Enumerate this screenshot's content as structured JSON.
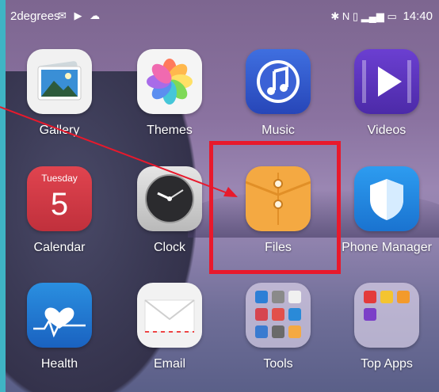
{
  "status_bar": {
    "carrier": "2degrees",
    "notification_icons": [
      "mail-icon",
      "cast-icon",
      "cloud-icon"
    ],
    "system_icons": [
      "bluetooth-icon",
      "nfc-icon",
      "vibrate-icon",
      "signal-icon",
      "battery-icon"
    ],
    "time": "14:40"
  },
  "apps": [
    {
      "id": "gallery",
      "label": "Gallery",
      "icon": "gallery-icon"
    },
    {
      "id": "themes",
      "label": "Themes",
      "icon": "themes-icon"
    },
    {
      "id": "music",
      "label": "Music",
      "icon": "music-icon"
    },
    {
      "id": "videos",
      "label": "Videos",
      "icon": "videos-icon"
    },
    {
      "id": "calendar",
      "label": "Calendar",
      "icon": "calendar-icon",
      "day_name": "Tuesday",
      "day_number": "5"
    },
    {
      "id": "clock",
      "label": "Clock",
      "icon": "clock-icon"
    },
    {
      "id": "files",
      "label": "Files",
      "icon": "files-icon"
    },
    {
      "id": "phone_manager",
      "label": "Phone Manager",
      "icon": "shield-icon"
    },
    {
      "id": "health",
      "label": "Health",
      "icon": "health-icon"
    },
    {
      "id": "email",
      "label": "Email",
      "icon": "email-icon"
    },
    {
      "id": "tools",
      "label": "Tools",
      "icon": "folder-icon"
    },
    {
      "id": "top_apps",
      "label": "Top Apps",
      "icon": "folder-icon"
    }
  ],
  "annotation": {
    "color": "#e8192c",
    "highlight": "files"
  }
}
